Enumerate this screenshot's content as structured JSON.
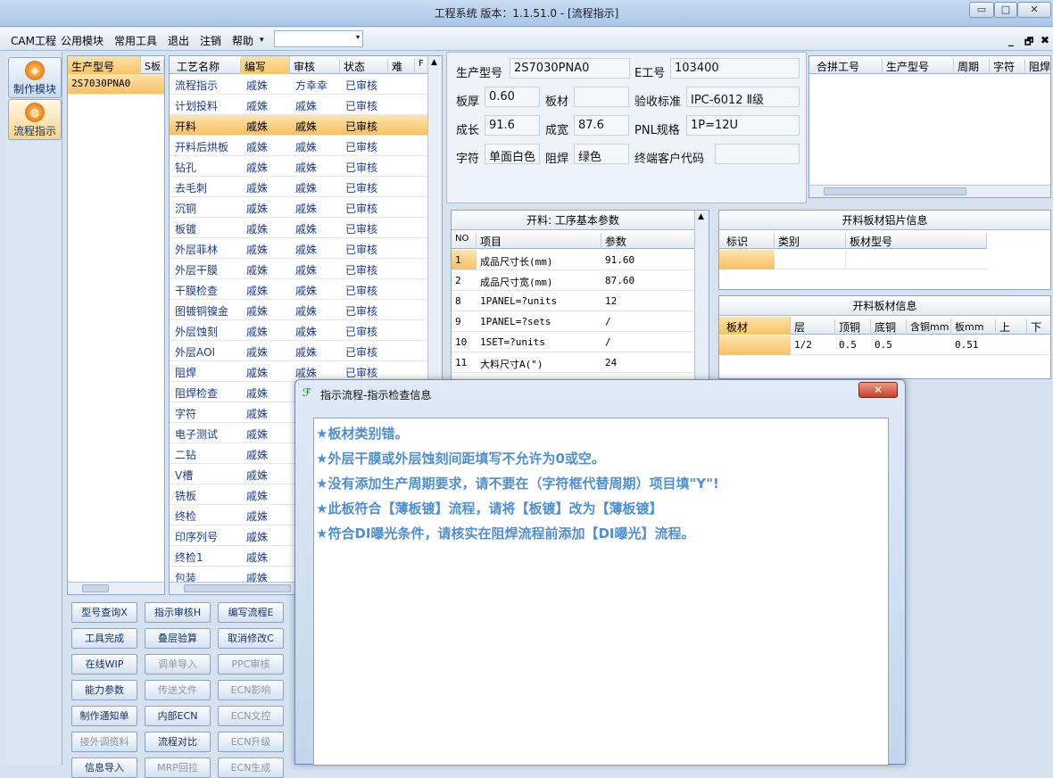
{
  "window": {
    "title": "工程系统  版本：1.1.51.0 - [流程指示]",
    "min": "▭",
    "max": "□",
    "close": "✕"
  },
  "menu": [
    "CAM工程",
    "公用模块",
    "常用工具",
    "退出",
    "注销",
    "帮助"
  ],
  "mdi": {
    "min": "_",
    "restore": "🗗",
    "close": "✖"
  },
  "leftbar": [
    {
      "label": "制作模块",
      "icon": "◈"
    },
    {
      "label": "流程指示",
      "icon": "◍"
    }
  ],
  "model_grid": {
    "headers": [
      "生产型号",
      "S板"
    ],
    "rows": [
      "2S7030PNA0"
    ]
  },
  "process_grid": {
    "headers": [
      "工艺名称",
      "编写",
      "审核",
      "状态",
      "难",
      "F"
    ],
    "rows": [
      [
        "流程指示",
        "戚姝",
        "方幸幸",
        "已审核"
      ],
      [
        "计划投料",
        "戚姝",
        "戚姝",
        "已审核"
      ],
      [
        "开料",
        "戚姝",
        "戚姝",
        "已审核"
      ],
      [
        "开料后烘板",
        "戚姝",
        "戚姝",
        "已审核"
      ],
      [
        "钻孔",
        "戚姝",
        "戚姝",
        "已审核"
      ],
      [
        "去毛刺",
        "戚姝",
        "戚姝",
        "已审核"
      ],
      [
        "沉铜",
        "戚姝",
        "戚姝",
        "已审核"
      ],
      [
        "板镀",
        "戚姝",
        "戚姝",
        "已审核"
      ],
      [
        "外层菲林",
        "戚姝",
        "戚姝",
        "已审核"
      ],
      [
        "外层干膜",
        "戚姝",
        "戚姝",
        "已审核"
      ],
      [
        "干膜检查",
        "戚姝",
        "戚姝",
        "已审核"
      ],
      [
        "图镀铜镍金",
        "戚姝",
        "戚姝",
        "已审核"
      ],
      [
        "外层蚀刻",
        "戚姝",
        "戚姝",
        "已审核"
      ],
      [
        "外层AOI",
        "戚姝",
        "戚姝",
        "已审核"
      ],
      [
        "阻焊",
        "戚姝",
        "戚姝",
        "已审核"
      ],
      [
        "阻焊检查",
        "戚姝",
        "",
        ""
      ],
      [
        "字符",
        "戚姝",
        "",
        ""
      ],
      [
        "电子测试",
        "戚姝",
        "",
        ""
      ],
      [
        "二钻",
        "戚姝",
        "",
        ""
      ],
      [
        "V槽",
        "戚姝",
        "",
        ""
      ],
      [
        "铣板",
        "戚姝",
        "",
        ""
      ],
      [
        "终检",
        "戚姝",
        "",
        ""
      ],
      [
        "印序列号",
        "戚姝",
        "",
        ""
      ],
      [
        "终检1",
        "戚姝",
        "",
        ""
      ],
      [
        "包装",
        "戚姝",
        "",
        ""
      ]
    ]
  },
  "buttons": [
    [
      {
        "t": "型号查询X",
        "d": false
      },
      {
        "t": "指示审核H",
        "d": false
      },
      {
        "t": "编写流程E",
        "d": false
      }
    ],
    [
      {
        "t": "工具完成",
        "d": false
      },
      {
        "t": "叠层验算",
        "d": false
      },
      {
        "t": "取消修改C",
        "d": false
      }
    ],
    [
      {
        "t": "在线WIP",
        "d": false
      },
      {
        "t": "调单导入",
        "d": true
      },
      {
        "t": "PPC审核",
        "d": true
      }
    ],
    [
      {
        "t": "能力参数",
        "d": false
      },
      {
        "t": "传送文件",
        "d": true
      },
      {
        "t": "ECN影响",
        "d": true
      }
    ],
    [
      {
        "t": "制作通知单",
        "d": false
      },
      {
        "t": "内部ECN",
        "d": false
      },
      {
        "t": "ECN文控",
        "d": true
      }
    ],
    [
      {
        "t": "接外调资料",
        "d": true
      },
      {
        "t": "流程对比",
        "d": false
      },
      {
        "t": "ECN升级",
        "d": true
      }
    ],
    [
      {
        "t": "信息导入",
        "d": false
      },
      {
        "t": "MRP回拉",
        "d": true
      },
      {
        "t": "ECN生成",
        "d": true
      }
    ]
  ],
  "info": {
    "model_label": "生产型号",
    "model": "2S7030PNA0",
    "eng_label": "E工号",
    "eng": "103400",
    "thick_label": "板厚",
    "thick": "0.60",
    "mat_label": "板材",
    "mat": "",
    "std_label": "验收标准",
    "std": "IPC-6012 Ⅱ级",
    "len_label": "成长",
    "len": "91.6",
    "wid_label": "成宽",
    "wid": "87.6",
    "pnl_label": "PNL规格",
    "pnl": "1P=12U",
    "char_label": "字符",
    "char": "单面白色",
    "mask_label": "阻焊",
    "mask": "绿色",
    "cust_label": "终端客户代码",
    "cust": ""
  },
  "merge_grid": {
    "headers": [
      "合拼工号",
      "生产型号",
      "周期",
      "字符",
      "阻焊"
    ]
  },
  "params": {
    "title": "开料: 工序基本参数",
    "headers": [
      "NO",
      "项目",
      "参数"
    ],
    "rows": [
      [
        "1",
        "成品尺寸长(mm)",
        "91.60"
      ],
      [
        "2",
        "成品尺寸宽(mm)",
        "87.60"
      ],
      [
        "8",
        "1PANEL=?units",
        "12"
      ],
      [
        "9",
        "1PANEL=?sets",
        "/"
      ],
      [
        "10",
        "1SET=?units",
        "/"
      ],
      [
        "11",
        "大料尺寸A(\")",
        "24"
      ]
    ]
  },
  "alu": {
    "title": "开料板材铝片信息",
    "headers": [
      "标识",
      "类别",
      "板材型号"
    ]
  },
  "sheet": {
    "title": "开料板材信息",
    "headers": [
      "板材",
      "层",
      "顶铜",
      "底铜",
      "含铜mm",
      "板mm",
      "上",
      "下"
    ],
    "row": [
      "",
      "1/2",
      "0.5",
      "0.5",
      "",
      "0.51",
      "",
      ""
    ]
  },
  "dialog": {
    "title": "指示流程-指示检查信息",
    "close": "✕",
    "messages": [
      "★板材类别错。",
      "★外层干膜或外层蚀刻间距填写不允许为0或空。",
      "★没有添加生产周期要求，请不要在（字符框代替周期）项目填\"Y\"!",
      "★此板符合【薄板镀】流程，请将【板镀】改为【薄板镀】",
      "★符合DI曝光条件，请核实在阻焊流程前添加【DI曝光】流程。"
    ]
  }
}
